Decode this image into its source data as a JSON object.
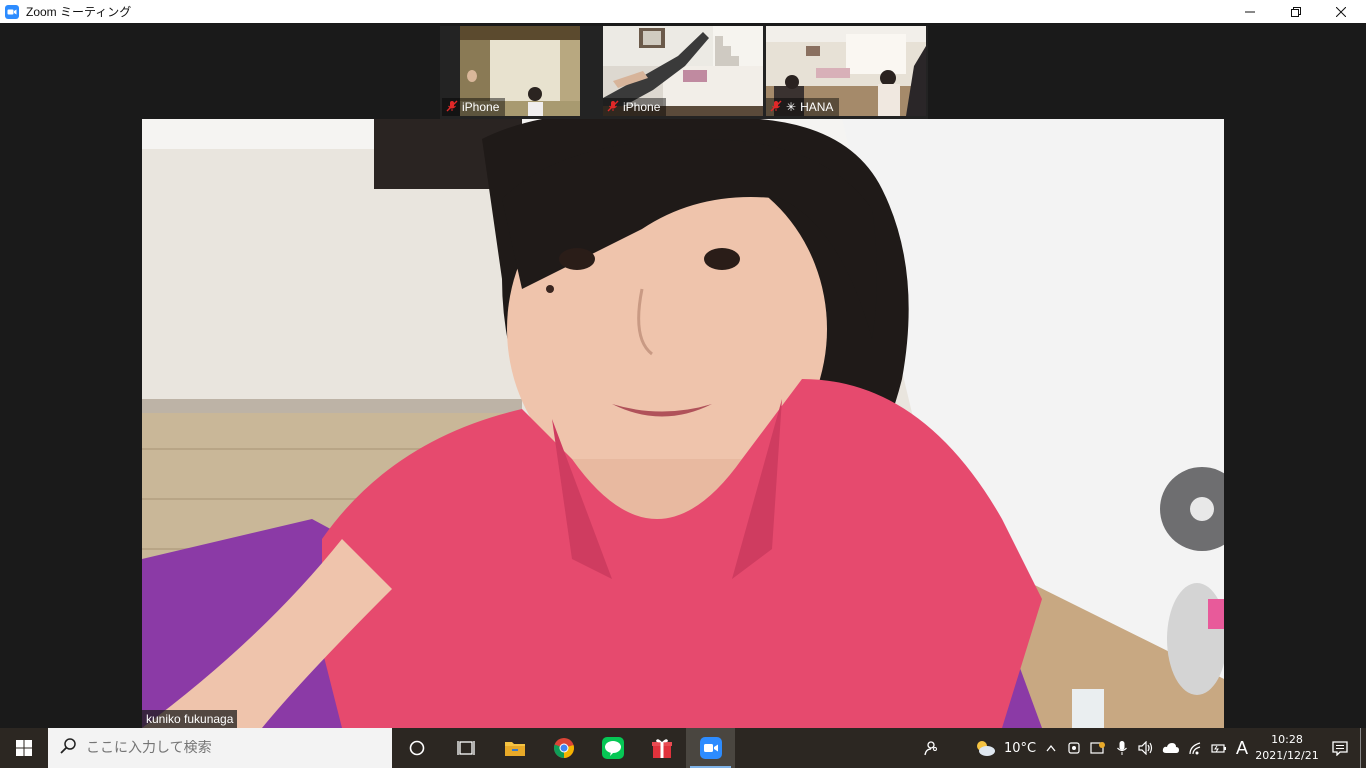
{
  "window": {
    "title": "Zoom ミーティング"
  },
  "participants": [
    {
      "name": "iPhone",
      "muted": true
    },
    {
      "name": "iPhone",
      "muted": true
    },
    {
      "name": "HANA",
      "muted": true
    }
  ],
  "speaker": {
    "name": "kuniko fukunaga"
  },
  "taskbar": {
    "search_placeholder": "ここに入力して検索",
    "temperature": "10°C",
    "ime_indicator": "A",
    "time": "10:28",
    "date": "2021/12/21"
  },
  "colors": {
    "zoom_blue": "#2d8cff",
    "taskbar_bg": "#2c2722",
    "mute_red": "#e02828"
  }
}
